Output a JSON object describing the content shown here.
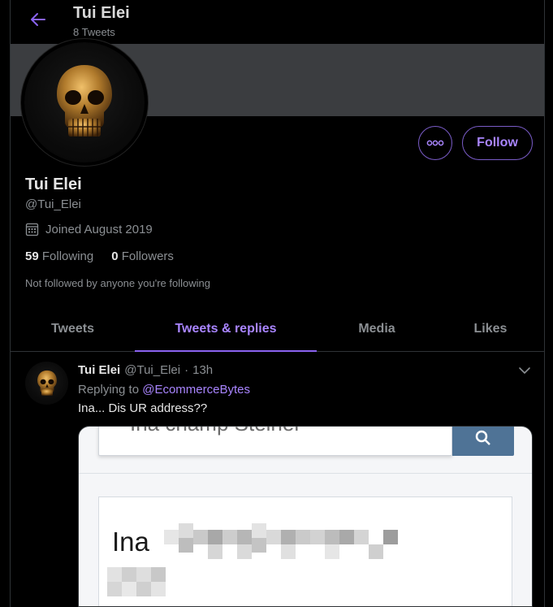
{
  "header": {
    "title": "Tui Elei",
    "tweet_count": "8 Tweets"
  },
  "profile": {
    "name": "Tui Elei",
    "handle": "@Tui_Elei",
    "joined": "Joined August 2019",
    "following_count": "59",
    "following_label": "Following",
    "followers_count": "0",
    "followers_label": "Followers",
    "not_followed_note": "Not followed by anyone you're following",
    "follow_label": "Follow"
  },
  "tabs": [
    {
      "label": "Tweets",
      "active": false
    },
    {
      "label": "Tweets & replies",
      "active": true
    },
    {
      "label": "Media",
      "active": false
    },
    {
      "label": "Likes",
      "active": false
    }
  ],
  "tweet": {
    "name": "Tui Elei",
    "handle": "@Tui_Elei",
    "separator": "·",
    "time": "13h",
    "replying_prefix": "Replying to",
    "replying_to": "@EcommerceBytes",
    "text": "Ina... Dis UR address??",
    "image": {
      "search_text": "Ina champ Steiner",
      "card_name": "Ina"
    }
  },
  "colors": {
    "accent": "#a985ff",
    "background": "#000000",
    "muted_text": "#8b8f93",
    "banner": "#3b3d40"
  },
  "icons": {
    "back": "arrow-left-icon",
    "more": "more-dots-icon",
    "calendar": "calendar-icon",
    "caret": "chevron-down-icon",
    "search": "search-icon"
  }
}
